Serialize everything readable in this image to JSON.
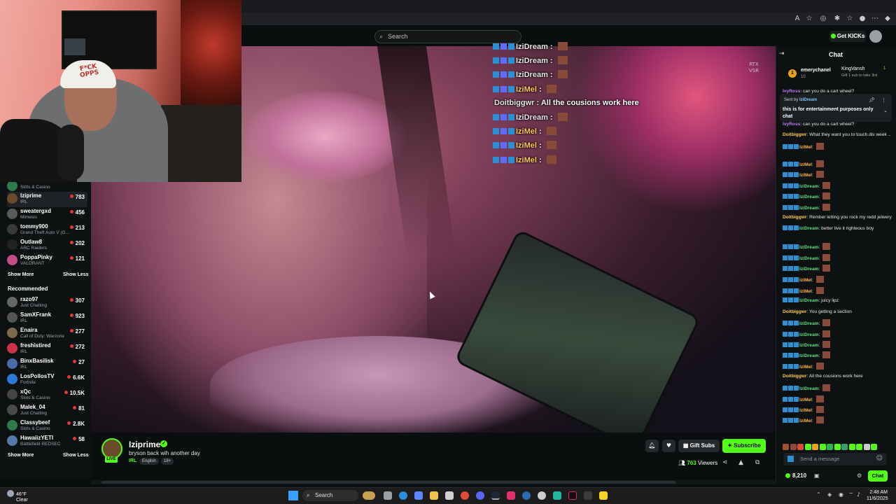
{
  "header": {
    "search_placeholder": "Search",
    "get_kicks_label": "Get KICKs"
  },
  "webcam": {
    "hat_text": "F*CK\nOPPS"
  },
  "sidebar": {
    "channels": [
      {
        "name": "Iziprime",
        "game": "IRL",
        "viewers": "783",
        "color": "#6b4a2a"
      },
      {
        "name": "sweatergxd",
        "game": "Mimesis",
        "viewers": "456",
        "color": "#5a5a5a"
      },
      {
        "name": "tommy900",
        "game": "Grand Theft Auto V (G...",
        "viewers": "213",
        "color": "#3a3a3a"
      },
      {
        "name": "Outlaw8",
        "game": "ARC Raiders",
        "viewers": "202",
        "color": "#222222"
      },
      {
        "name": "PoppaPinky",
        "game": "VALORANT",
        "viewers": "121",
        "color": "#c44b88"
      }
    ],
    "partial_channel_game": "Slots & Casino",
    "show_more_1": "Show More",
    "show_less_1": "Show Less",
    "recommended_title": "Recommended",
    "recommended": [
      {
        "name": "razo97",
        "game": "Just Chatting",
        "viewers": "307",
        "color": "#666666"
      },
      {
        "name": "SamXFrank",
        "game": "IRL",
        "viewers": "923",
        "color": "#555555"
      },
      {
        "name": "Enaira",
        "game": "Call of Duty: Warzone",
        "viewers": "277",
        "color": "#7a6a4a"
      },
      {
        "name": "freshistired",
        "game": "IRL",
        "viewers": "272",
        "color": "#cc3344"
      },
      {
        "name": "BinxBasilisk",
        "game": "IRL",
        "viewers": "27",
        "color": "#4a6aa8"
      },
      {
        "name": "LosPollosTV",
        "game": "Fortnite",
        "viewers": "6.6K",
        "color": "#2a7ad8"
      },
      {
        "name": "xQc",
        "game": "Slots & Casino",
        "viewers": "10.5K",
        "color": "#444444"
      },
      {
        "name": "Malek_04",
        "game": "Just Chatting",
        "viewers": "81",
        "color": "#4a4a4a"
      },
      {
        "name": "Classybeef",
        "game": "Slots & Casino",
        "viewers": "2.8K",
        "color": "#2d7a4a"
      },
      {
        "name": "HawaiizYETI",
        "game": "Battlefield REDSEC",
        "viewers": "58",
        "color": "#5577aa"
      }
    ],
    "show_more_2": "Show More",
    "show_less_2": "Show Less"
  },
  "video": {
    "rtx_label": "RTX\nVSR",
    "overlay_chat": [
      {
        "user": "IziDream",
        "text": "",
        "emote": true
      },
      {
        "user": "IziDream",
        "text": "",
        "emote": true
      },
      {
        "user": "IziDream",
        "text": "",
        "emote": true
      },
      {
        "user": "IziMel",
        "text": "",
        "emote": true
      },
      {
        "user": "Doitbiggwr",
        "text": "All the cousions work here",
        "emote": false
      },
      {
        "user": "IziDream",
        "text": "",
        "emote": true
      },
      {
        "user": "IziMel",
        "text": "",
        "emote": true
      },
      {
        "user": "IziMel",
        "text": "",
        "emote": true
      },
      {
        "user": "IziMel",
        "text": "",
        "emote": true
      }
    ]
  },
  "stream": {
    "streamer": "Iziprime",
    "live_label": "LIVE",
    "title": "bryson back wih another day",
    "category": "IRL",
    "tags": [
      "English",
      "18+"
    ],
    "gift_subs_label": "Gift Subs",
    "subscribe_label": "Subscribe",
    "viewer_count": "763",
    "viewers_label": "Viewers"
  },
  "chat": {
    "title": "Chat",
    "top_gifter": {
      "name": "emerychanel",
      "count": "10"
    },
    "gifter_2": {
      "name": "KingVansh",
      "count": "1",
      "sub": "Gift 1 sub to take 3rd"
    },
    "pinned_sent_by": "Sent by",
    "pinned_user": "IziDream",
    "pinned_text": "this is for entertainment purposes only chat",
    "messages": [
      {
        "user": "IvyRoss",
        "color": "p",
        "text": "can you do a cart wheel?",
        "badges": 0,
        "emote": false
      },
      {
        "user": "IvyRoss",
        "color": "p",
        "text": "can you do a cart wheel?",
        "badges": 0,
        "emote": false
      },
      {
        "user": "Doitbiggwr",
        "color": "y",
        "text": "What they want you to touch dis week ..",
        "badges": 0,
        "emote": false
      },
      {
        "user": "IziMel",
        "color": "o",
        "text": "",
        "badges": 3,
        "emote": true
      },
      {
        "user": "IziMel",
        "color": "o",
        "text": "",
        "badges": 3,
        "emote": true
      },
      {
        "user": "IziMel",
        "color": "o",
        "text": "",
        "badges": 3,
        "emote": true
      },
      {
        "user": "IziDream",
        "color": "g",
        "text": "",
        "badges": 3,
        "emote": true
      },
      {
        "user": "IziDream",
        "color": "g",
        "text": "",
        "badges": 3,
        "emote": true
      },
      {
        "user": "IziDream",
        "color": "g",
        "text": "",
        "badges": 3,
        "emote": true
      },
      {
        "user": "Doitbiggwr",
        "color": "y",
        "text": "Rember letting you rock my redd jelwery",
        "badges": 0,
        "emote": false
      },
      {
        "user": "IziDream",
        "color": "g",
        "text": "better live it righteous boy",
        "badges": 3,
        "emote": false
      },
      {
        "user": "IziDream",
        "color": "g",
        "text": "",
        "badges": 3,
        "emote": true
      },
      {
        "user": "IziDream",
        "color": "g",
        "text": "",
        "badges": 3,
        "emote": true
      },
      {
        "user": "IziDream",
        "color": "g",
        "text": "",
        "badges": 3,
        "emote": true
      },
      {
        "user": "IziMel",
        "color": "o",
        "text": "",
        "badges": 3,
        "emote": true
      },
      {
        "user": "IziMel",
        "color": "o",
        "text": "",
        "badges": 3,
        "emote": true
      },
      {
        "user": "IziDream",
        "color": "g",
        "text": "juicy lipz",
        "badges": 3,
        "emote": false
      },
      {
        "user": "Doitbiggwr",
        "color": "y",
        "text": "You getting a section",
        "badges": 0,
        "emote": false
      },
      {
        "user": "IziDream",
        "color": "g",
        "text": "",
        "badges": 3,
        "emote": true
      },
      {
        "user": "IziDream",
        "color": "g",
        "text": "",
        "badges": 3,
        "emote": true
      },
      {
        "user": "IziDream",
        "color": "g",
        "text": "",
        "badges": 3,
        "emote": true
      },
      {
        "user": "IziDream",
        "color": "g",
        "text": "",
        "badges": 3,
        "emote": true
      },
      {
        "user": "IziMel",
        "color": "o",
        "text": "",
        "badges": 3,
        "emote": true
      },
      {
        "user": "Doitbiggwr",
        "color": "y",
        "text": "All the cousions work here",
        "badges": 0,
        "emote": false
      },
      {
        "user": "IziDream",
        "color": "g",
        "text": "",
        "badges": 3,
        "emote": true
      },
      {
        "user": "IziMel",
        "color": "o",
        "text": "",
        "badges": 3,
        "emote": true
      },
      {
        "user": "IziMel",
        "color": "o",
        "text": "",
        "badges": 3,
        "emote": true
      },
      {
        "user": "IziMel",
        "color": "o",
        "text": "",
        "badges": 3,
        "emote": true
      }
    ],
    "send_placeholder": "Send a message",
    "points": "8,210",
    "chat_button": "Chat"
  },
  "taskbar": {
    "temperature": "46°F",
    "weather": "Clear",
    "search_label": "Search",
    "time": "2:48 AM",
    "date": "11/6/2025"
  },
  "colors": {
    "accent": "#53fc18",
    "background": "#0b0e0f"
  }
}
